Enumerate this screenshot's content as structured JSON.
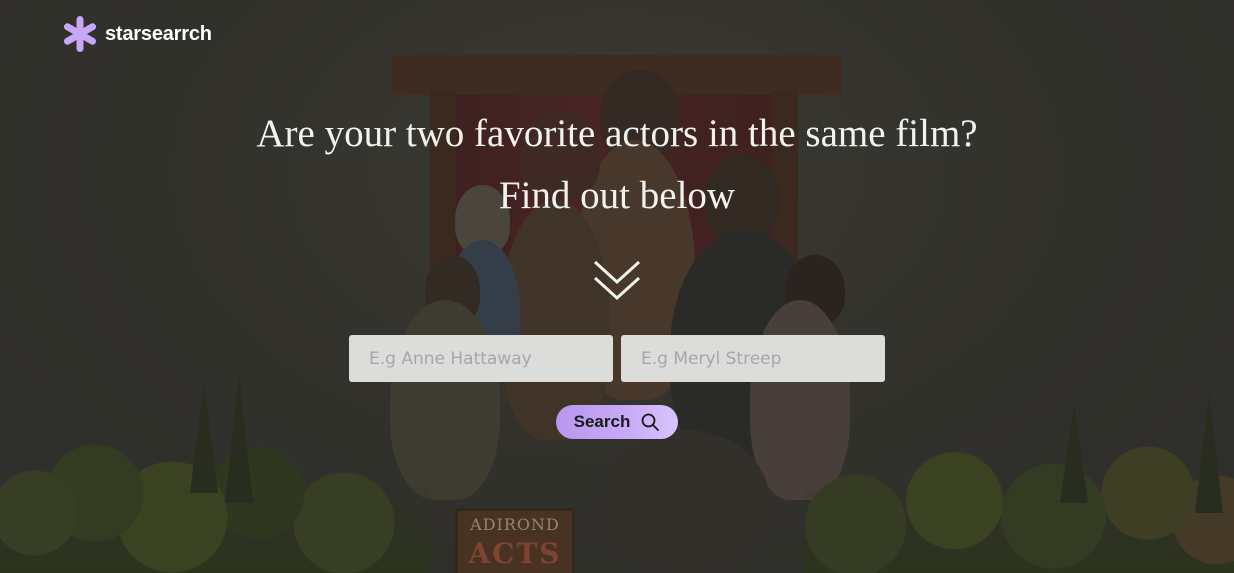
{
  "header": {
    "brand": "starsearrch",
    "logo_icon": "asterisk-logo-icon",
    "logo_color": "#c6a6f5"
  },
  "hero": {
    "headline": "Are your two favorite actors in the same film?",
    "subheadline": "Find out below",
    "scroll_icon": "double-chevron-down-icon"
  },
  "form": {
    "actor1_placeholder": "E.g Anne Hattaway",
    "actor2_placeholder": "E.g Meryl Streep",
    "search_label": "Search",
    "search_icon": "search-icon",
    "button_color": "#c9abf7"
  },
  "background": {
    "sign_line1": "ADIROND",
    "sign_line2": "ACTS"
  }
}
